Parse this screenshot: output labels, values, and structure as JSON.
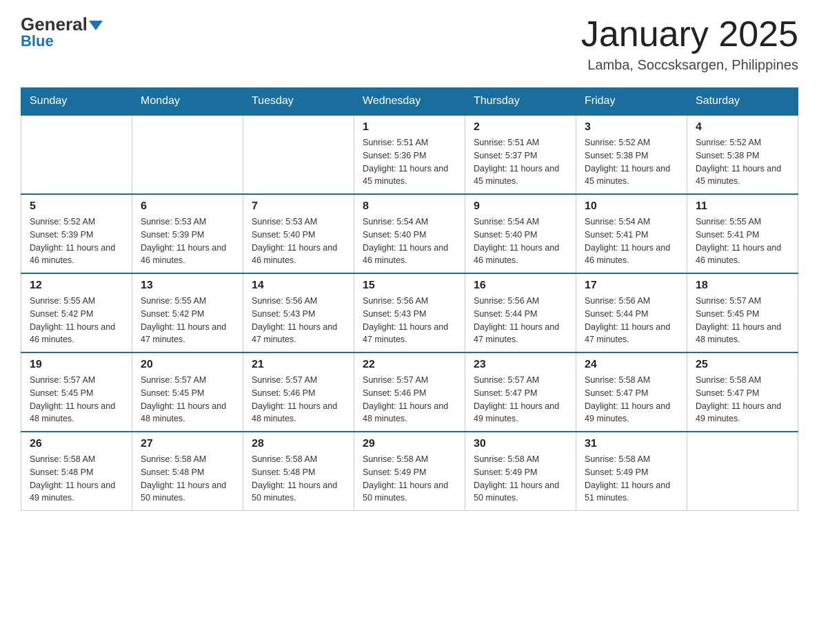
{
  "logo": {
    "general": "General",
    "blue": "Blue"
  },
  "title": "January 2025",
  "location": "Lamba, Soccsksargen, Philippines",
  "headers": [
    "Sunday",
    "Monday",
    "Tuesday",
    "Wednesday",
    "Thursday",
    "Friday",
    "Saturday"
  ],
  "weeks": [
    [
      null,
      null,
      null,
      {
        "day": "1",
        "sunrise": "5:51 AM",
        "sunset": "5:36 PM",
        "daylight": "11 hours and 45 minutes."
      },
      {
        "day": "2",
        "sunrise": "5:51 AM",
        "sunset": "5:37 PM",
        "daylight": "11 hours and 45 minutes."
      },
      {
        "day": "3",
        "sunrise": "5:52 AM",
        "sunset": "5:38 PM",
        "daylight": "11 hours and 45 minutes."
      },
      {
        "day": "4",
        "sunrise": "5:52 AM",
        "sunset": "5:38 PM",
        "daylight": "11 hours and 45 minutes."
      }
    ],
    [
      {
        "day": "5",
        "sunrise": "5:52 AM",
        "sunset": "5:39 PM",
        "daylight": "11 hours and 46 minutes."
      },
      {
        "day": "6",
        "sunrise": "5:53 AM",
        "sunset": "5:39 PM",
        "daylight": "11 hours and 46 minutes."
      },
      {
        "day": "7",
        "sunrise": "5:53 AM",
        "sunset": "5:40 PM",
        "daylight": "11 hours and 46 minutes."
      },
      {
        "day": "8",
        "sunrise": "5:54 AM",
        "sunset": "5:40 PM",
        "daylight": "11 hours and 46 minutes."
      },
      {
        "day": "9",
        "sunrise": "5:54 AM",
        "sunset": "5:40 PM",
        "daylight": "11 hours and 46 minutes."
      },
      {
        "day": "10",
        "sunrise": "5:54 AM",
        "sunset": "5:41 PM",
        "daylight": "11 hours and 46 minutes."
      },
      {
        "day": "11",
        "sunrise": "5:55 AM",
        "sunset": "5:41 PM",
        "daylight": "11 hours and 46 minutes."
      }
    ],
    [
      {
        "day": "12",
        "sunrise": "5:55 AM",
        "sunset": "5:42 PM",
        "daylight": "11 hours and 46 minutes."
      },
      {
        "day": "13",
        "sunrise": "5:55 AM",
        "sunset": "5:42 PM",
        "daylight": "11 hours and 47 minutes."
      },
      {
        "day": "14",
        "sunrise": "5:56 AM",
        "sunset": "5:43 PM",
        "daylight": "11 hours and 47 minutes."
      },
      {
        "day": "15",
        "sunrise": "5:56 AM",
        "sunset": "5:43 PM",
        "daylight": "11 hours and 47 minutes."
      },
      {
        "day": "16",
        "sunrise": "5:56 AM",
        "sunset": "5:44 PM",
        "daylight": "11 hours and 47 minutes."
      },
      {
        "day": "17",
        "sunrise": "5:56 AM",
        "sunset": "5:44 PM",
        "daylight": "11 hours and 47 minutes."
      },
      {
        "day": "18",
        "sunrise": "5:57 AM",
        "sunset": "5:45 PM",
        "daylight": "11 hours and 48 minutes."
      }
    ],
    [
      {
        "day": "19",
        "sunrise": "5:57 AM",
        "sunset": "5:45 PM",
        "daylight": "11 hours and 48 minutes."
      },
      {
        "day": "20",
        "sunrise": "5:57 AM",
        "sunset": "5:45 PM",
        "daylight": "11 hours and 48 minutes."
      },
      {
        "day": "21",
        "sunrise": "5:57 AM",
        "sunset": "5:46 PM",
        "daylight": "11 hours and 48 minutes."
      },
      {
        "day": "22",
        "sunrise": "5:57 AM",
        "sunset": "5:46 PM",
        "daylight": "11 hours and 48 minutes."
      },
      {
        "day": "23",
        "sunrise": "5:57 AM",
        "sunset": "5:47 PM",
        "daylight": "11 hours and 49 minutes."
      },
      {
        "day": "24",
        "sunrise": "5:58 AM",
        "sunset": "5:47 PM",
        "daylight": "11 hours and 49 minutes."
      },
      {
        "day": "25",
        "sunrise": "5:58 AM",
        "sunset": "5:47 PM",
        "daylight": "11 hours and 49 minutes."
      }
    ],
    [
      {
        "day": "26",
        "sunrise": "5:58 AM",
        "sunset": "5:48 PM",
        "daylight": "11 hours and 49 minutes."
      },
      {
        "day": "27",
        "sunrise": "5:58 AM",
        "sunset": "5:48 PM",
        "daylight": "11 hours and 50 minutes."
      },
      {
        "day": "28",
        "sunrise": "5:58 AM",
        "sunset": "5:48 PM",
        "daylight": "11 hours and 50 minutes."
      },
      {
        "day": "29",
        "sunrise": "5:58 AM",
        "sunset": "5:49 PM",
        "daylight": "11 hours and 50 minutes."
      },
      {
        "day": "30",
        "sunrise": "5:58 AM",
        "sunset": "5:49 PM",
        "daylight": "11 hours and 50 minutes."
      },
      {
        "day": "31",
        "sunrise": "5:58 AM",
        "sunset": "5:49 PM",
        "daylight": "11 hours and 51 minutes."
      },
      null
    ]
  ]
}
